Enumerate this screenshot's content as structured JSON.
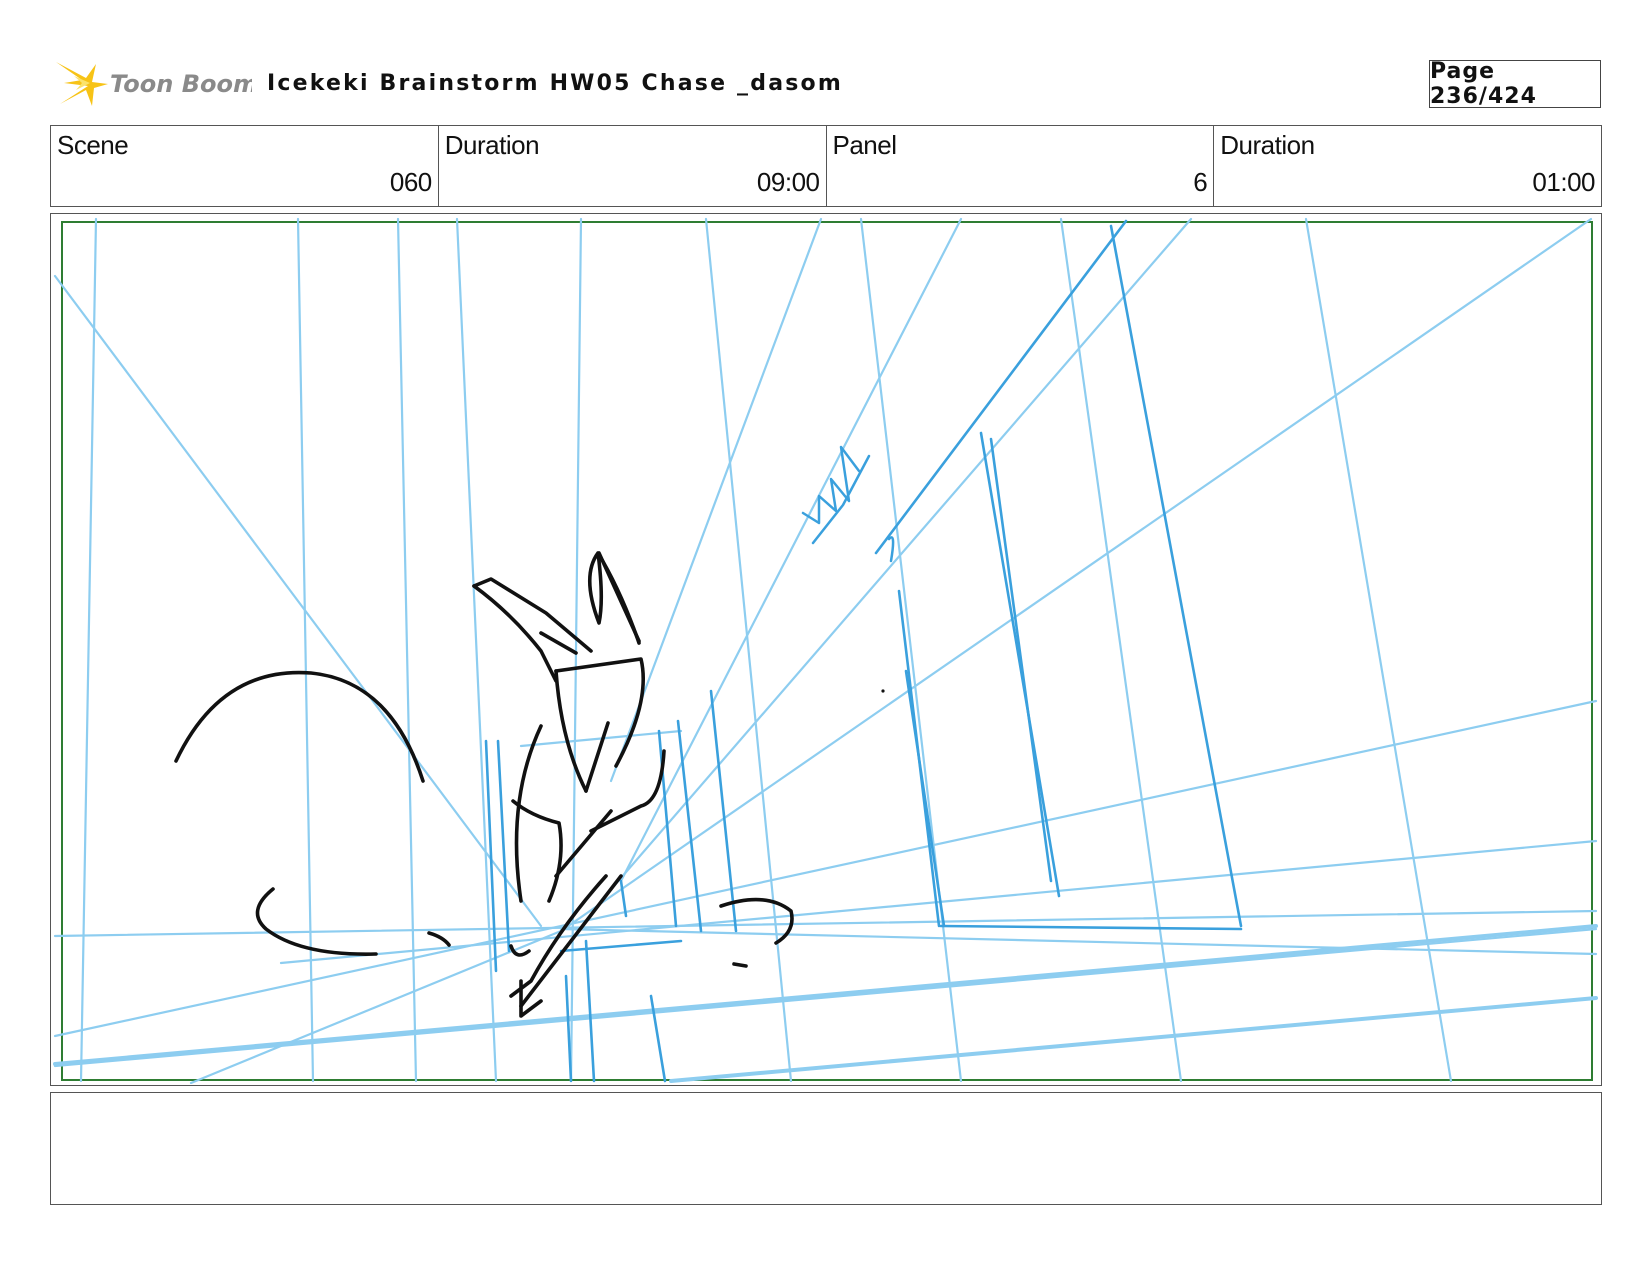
{
  "header": {
    "logo_text": "Toon Boom",
    "title": "Icekeki Brainstorm HW05 Chase _dasom",
    "page": "Page 236/424"
  },
  "info": {
    "scene_label": "Scene",
    "scene_value": "060",
    "duration_label": "Duration",
    "duration_value": "09:00",
    "panel_label": "Panel",
    "panel_value": "6",
    "panel_duration_label": "Duration",
    "panel_duration_value": "01:00"
  },
  "colors": {
    "guide_line": "#8dcdf0",
    "guide_line_strong": "#3aa0dd",
    "sketch": "#111111",
    "safe_frame": "#2e7d32",
    "logo_star": "#f7c316",
    "logo_text": "#888888"
  }
}
